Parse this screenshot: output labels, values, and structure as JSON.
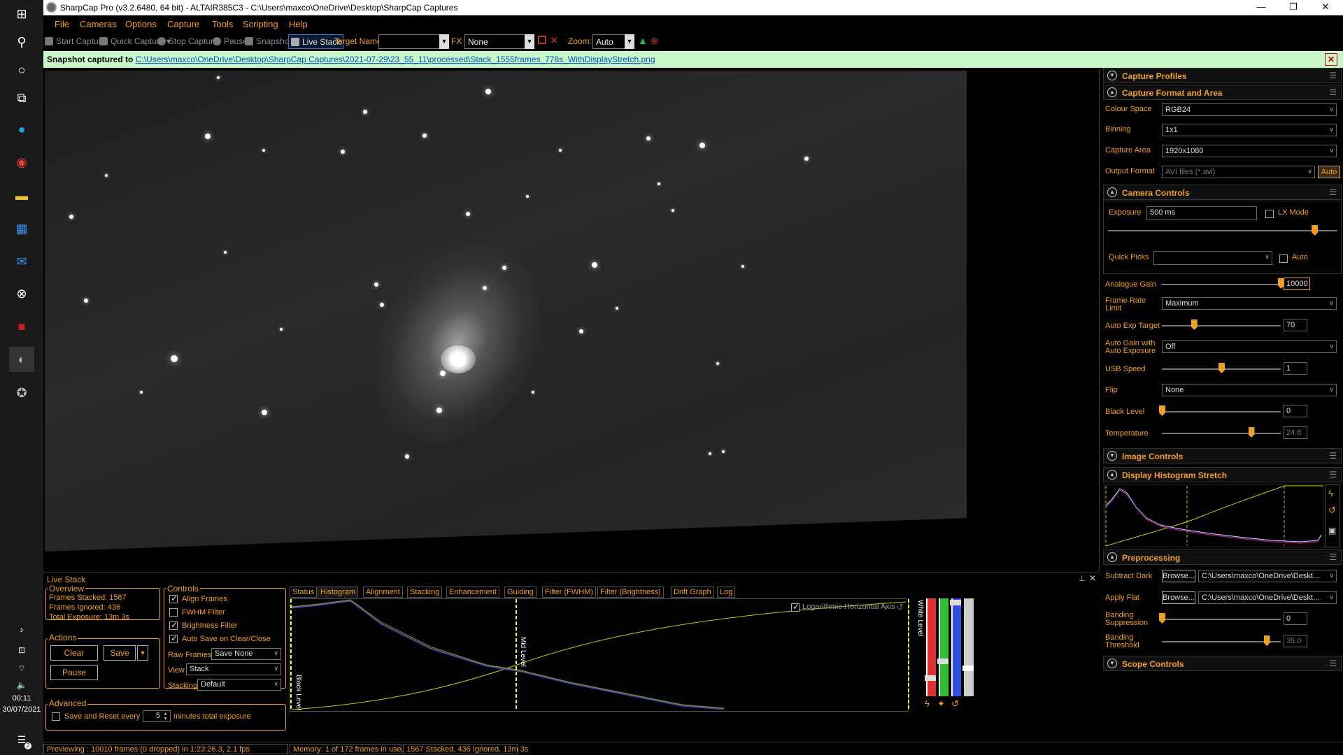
{
  "window": {
    "title": "SharpCap Pro (v3.2.6480, 64 bit) - ALTAIR385C3 - C:\\Users\\maxco\\OneDrive\\Desktop\\SharpCap Captures",
    "minimize": "—",
    "maximize": "❐",
    "close": "✕"
  },
  "menu": [
    "File",
    "Cameras",
    "Options",
    "Capture",
    "Tools",
    "Scripting",
    "Help"
  ],
  "toolbar": {
    "start_capture": "Start Capture",
    "quick_capture": "Quick Capture",
    "stop_capture": "Stop Capture",
    "pause": "Pause",
    "snapshot": "Snapshot",
    "live_stack": "Live Stack",
    "target_name_label": "Target Name :",
    "target_name_value": "",
    "fx_label": "FX :",
    "fx_value": "None",
    "zoom_label": "Zoom:",
    "zoom_value": "Auto"
  },
  "notification": {
    "prefix": "Snapshot captured to ",
    "path": "C:\\Users\\maxco\\OneDrive\\Desktop\\SharpCap Captures\\2021-07-29\\23_55_11\\processed\\Stack_1555frames_778s_WithDisplayStretch.png",
    "close": "✕"
  },
  "taskbar": {
    "clock_time": "00:11",
    "clock_date": "30/07/2021",
    "notification_count": "2"
  },
  "right_panel": {
    "sections": {
      "capture_profiles": "Capture Profiles",
      "capture_format": "Capture Format and Area",
      "camera_controls": "Camera Controls",
      "image_controls": "Image Controls",
      "display_histogram": "Display Histogram Stretch",
      "preprocessing": "Preprocessing",
      "scope_controls": "Scope Controls"
    },
    "capture_format": {
      "colour_space_label": "Colour Space",
      "colour_space": "RGB24",
      "binning_label": "Binning",
      "binning": "1x1",
      "capture_area_label": "Capture Area",
      "capture_area": "1920x1080",
      "output_format_label": "Output Format",
      "output_format": "AVI files (*.avi)",
      "auto_label": "Auto"
    },
    "camera_controls": {
      "exposure_label": "Exposure",
      "exposure": "500 ms",
      "lx_mode": "LX Mode",
      "exposure_slider": 0.9,
      "quick_picks_label": "Quick Picks",
      "quick_picks": "",
      "quick_auto": "Auto",
      "analogue_gain_label": "Analogue Gain",
      "analogue_gain": "10000",
      "analogue_gain_slider": 1.0,
      "frame_rate_label_1": "Frame Rate",
      "frame_rate_label_2": "Limit",
      "frame_rate": "Maximum",
      "auto_exp_target_label": "Auto Exp Target",
      "auto_exp_target": "70",
      "auto_exp_target_slider": 0.27,
      "auto_gain_label_1": "Auto Gain with",
      "auto_gain_label_2": "Auto Exposure",
      "auto_gain": "Off",
      "usb_speed_label": "USB Speed",
      "usb_speed": "1",
      "usb_speed_slider": 0.5,
      "flip_label": "Flip",
      "flip": "None",
      "black_level_label": "Black Level",
      "black_level": "0",
      "black_level_slider": 0.0,
      "temperature_label": "Temperature",
      "temperature": "24.6",
      "temperature_slider": 0.75
    },
    "preprocessing": {
      "subtract_dark_label": "Subtract Dark",
      "browse": "Browse...",
      "subtract_dark_path": "C:\\Users\\maxco\\OneDrive\\Deskt...",
      "apply_flat_label": "Apply Flat",
      "apply_flat_path": "C:\\Users\\maxco\\OneDrive\\Deskt...",
      "banding_suppression_label_1": "Banding",
      "banding_suppression_label_2": "Suppression",
      "banding_suppression": "0",
      "banding_suppression_slider": 0.0,
      "banding_threshold_label_1": "Banding",
      "banding_threshold_label_2": "Threshold",
      "banding_threshold": "35.0",
      "banding_threshold_slider": 0.88
    }
  },
  "live_stack": {
    "title": "Live Stack",
    "overview": {
      "label": "Overview",
      "frames_stacked": "Frames Stacked: 1567",
      "frames_ignored": "Frames Ignored:  436",
      "total_exposure": "Total Exposure:   13m 3s"
    },
    "actions": {
      "label": "Actions",
      "clear": "Clear",
      "save": "Save",
      "pause": "Pause"
    },
    "controls": {
      "label": "Controls",
      "align_frames": "Align Frames",
      "fwhm_filter": "FWHM Filter",
      "brightness_filter": "Brightness Filter",
      "auto_save": "Auto Save on Clear/Close",
      "raw_frames_label": "Raw Frames",
      "raw_frames": "Save None",
      "view_label": "View",
      "view": "Stack",
      "stacking_label": "Stacking",
      "stacking": "Default"
    },
    "advanced": {
      "label": "Advanced",
      "save_reset": "Save and Reset every",
      "minutes": "5",
      "minutes_suffix": "minutes total exposure"
    },
    "tabs": [
      "Status",
      "Histogram",
      "Alignment",
      "Stacking",
      "Enhancement",
      "Guiding",
      "Filter (FWHM)",
      "Filter (Brightness)",
      "Drift Graph",
      "Log"
    ],
    "selected_tab": "Histogram",
    "histogram": {
      "log_axis": "Logarithmic Horizontal Axis",
      "black_level": "Black Level",
      "mid_level": "Mid Level",
      "white_level": "White Level"
    }
  },
  "statusbar": {
    "previewing": "Previewing : 10010 frames (0 dropped) in 1:23:26.3, 2.1 fps",
    "memory": "Memory: 1 of 172 frames in use.",
    "stack": "1567 Stacked, 436 Ignored, 13m 3s"
  },
  "colors": {
    "accent": "#f0a020",
    "notify_bg": "#c8f7c8",
    "link": "#0050c8"
  }
}
